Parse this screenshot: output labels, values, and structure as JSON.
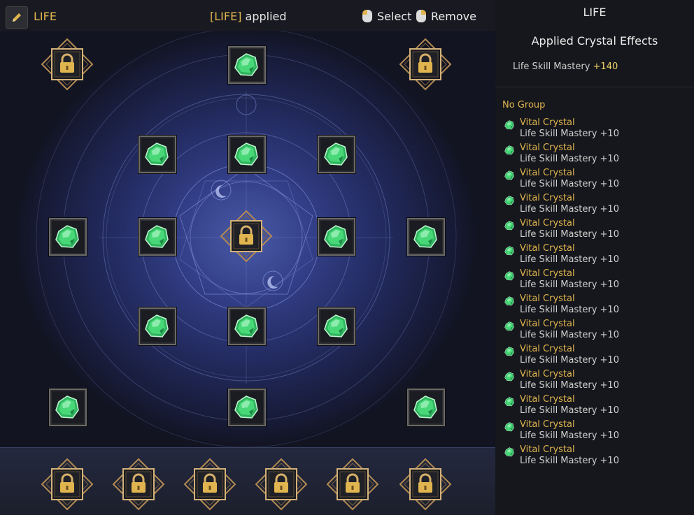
{
  "header": {
    "mode_label": "LIFE",
    "applied_tag": "[LIFE]",
    "applied_text": " applied",
    "select_label": "Select",
    "remove_label": "Remove"
  },
  "icons": {
    "edit": "pencil-icon",
    "select": "mouse-left-icon",
    "remove": "mouse-right-icon",
    "crystal": "green-crystal-icon",
    "locked": "padlock-icon"
  },
  "colors": {
    "accent": "#e0b54f",
    "crystal": "#3ac46a",
    "panel": "#16171c"
  },
  "board": {
    "slots": [
      {
        "state": "locked"
      },
      {
        "state": "crystal"
      },
      {
        "state": "locked"
      },
      {
        "state": "crystal"
      },
      {
        "state": "crystal"
      },
      {
        "state": "crystal"
      },
      {
        "state": "crystal"
      },
      {
        "state": "crystal"
      },
      {
        "state": "locked"
      },
      {
        "state": "crystal"
      },
      {
        "state": "crystal"
      },
      {
        "state": "crystal"
      },
      {
        "state": "crystal"
      },
      {
        "state": "crystal"
      },
      {
        "state": "crystal"
      },
      {
        "state": "crystal"
      },
      {
        "state": "crystal"
      }
    ],
    "bottom_slots": [
      {
        "state": "locked"
      },
      {
        "state": "locked"
      },
      {
        "state": "locked"
      },
      {
        "state": "locked"
      },
      {
        "state": "locked"
      },
      {
        "state": "locked"
      }
    ]
  },
  "panel": {
    "title": "LIFE",
    "subtitle": "Applied Crystal Effects",
    "stat_name": "Life Skill Mastery ",
    "stat_value": "+140",
    "group_label": "No Group",
    "crystals": [
      {
        "name": "Vital Crystal",
        "effect": "Life Skill Mastery +10"
      },
      {
        "name": "Vital Crystal",
        "effect": "Life Skill Mastery +10"
      },
      {
        "name": "Vital Crystal",
        "effect": "Life Skill Mastery +10"
      },
      {
        "name": "Vital Crystal",
        "effect": "Life Skill Mastery +10"
      },
      {
        "name": "Vital Crystal",
        "effect": "Life Skill Mastery +10"
      },
      {
        "name": "Vital Crystal",
        "effect": "Life Skill Mastery +10"
      },
      {
        "name": "Vital Crystal",
        "effect": "Life Skill Mastery +10"
      },
      {
        "name": "Vital Crystal",
        "effect": "Life Skill Mastery +10"
      },
      {
        "name": "Vital Crystal",
        "effect": "Life Skill Mastery +10"
      },
      {
        "name": "Vital Crystal",
        "effect": "Life Skill Mastery +10"
      },
      {
        "name": "Vital Crystal",
        "effect": "Life Skill Mastery +10"
      },
      {
        "name": "Vital Crystal",
        "effect": "Life Skill Mastery +10"
      },
      {
        "name": "Vital Crystal",
        "effect": "Life Skill Mastery +10"
      },
      {
        "name": "Vital Crystal",
        "effect": "Life Skill Mastery +10"
      }
    ]
  }
}
